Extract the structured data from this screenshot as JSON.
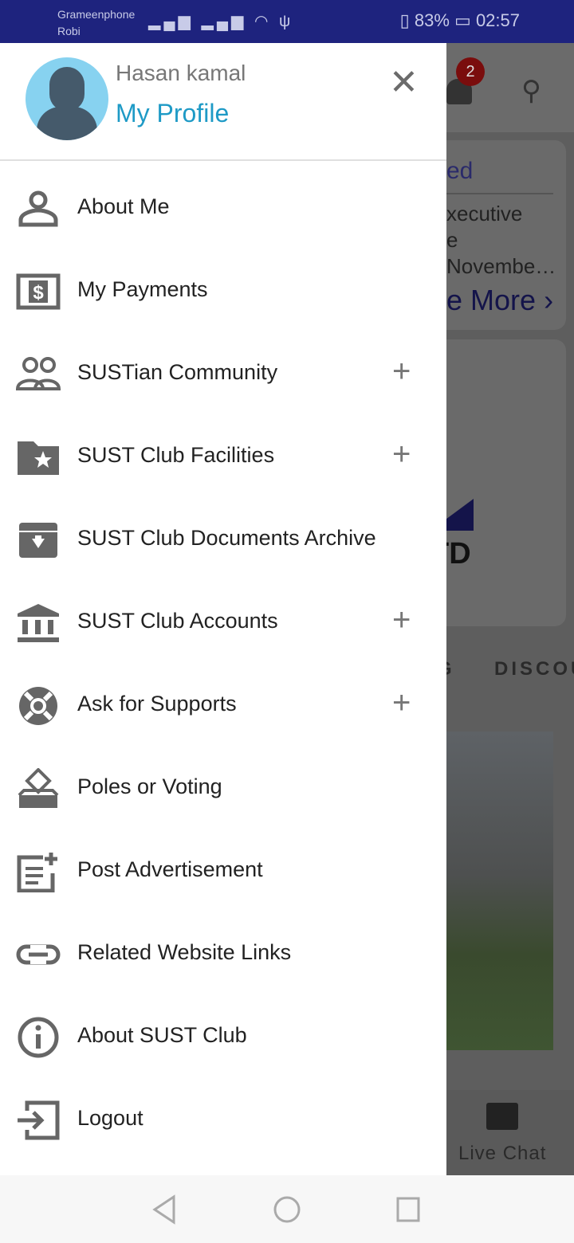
{
  "status_bar": {
    "carrier1": "Grameenphone",
    "carrier2": "Robi",
    "battery": "83%",
    "time": "02:57"
  },
  "background": {
    "notification_count": "2",
    "card_title": "ed",
    "card_body": "xecutive\ne\nNovembe…",
    "card_more": "e More",
    "card_logo": "TD",
    "tabs": [
      "G",
      "DISCOU"
    ],
    "live_chat": "Live Chat"
  },
  "drawer": {
    "user_name": "Hasan kamal",
    "profile_link": "My Profile",
    "items": [
      {
        "label": "About Me",
        "icon": "person-icon",
        "expandable": false
      },
      {
        "label": "My Payments",
        "icon": "payment-icon",
        "expandable": false
      },
      {
        "label": "SUSTian Community",
        "icon": "people-icon",
        "expandable": true
      },
      {
        "label": "SUST Club Facilities",
        "icon": "folder-star-icon",
        "expandable": true
      },
      {
        "label": "SUST Club Documents Archive",
        "icon": "archive-icon",
        "expandable": false
      },
      {
        "label": "SUST Club Accounts",
        "icon": "bank-icon",
        "expandable": true
      },
      {
        "label": "Ask for Supports",
        "icon": "lifebuoy-icon",
        "expandable": true
      },
      {
        "label": "Poles or Voting",
        "icon": "ballot-icon",
        "expandable": false
      },
      {
        "label": "Post Advertisement",
        "icon": "post-add-icon",
        "expandable": false
      },
      {
        "label": "Related Website Links",
        "icon": "link-icon",
        "expandable": false
      },
      {
        "label": "About SUST Club",
        "icon": "info-icon",
        "expandable": false
      },
      {
        "label": "Logout",
        "icon": "logout-icon",
        "expandable": false
      }
    ],
    "plus_symbol": "+"
  },
  "colors": {
    "status_bar": "#1e237e",
    "profile_link": "#1e9ac6",
    "icon": "#666666"
  }
}
